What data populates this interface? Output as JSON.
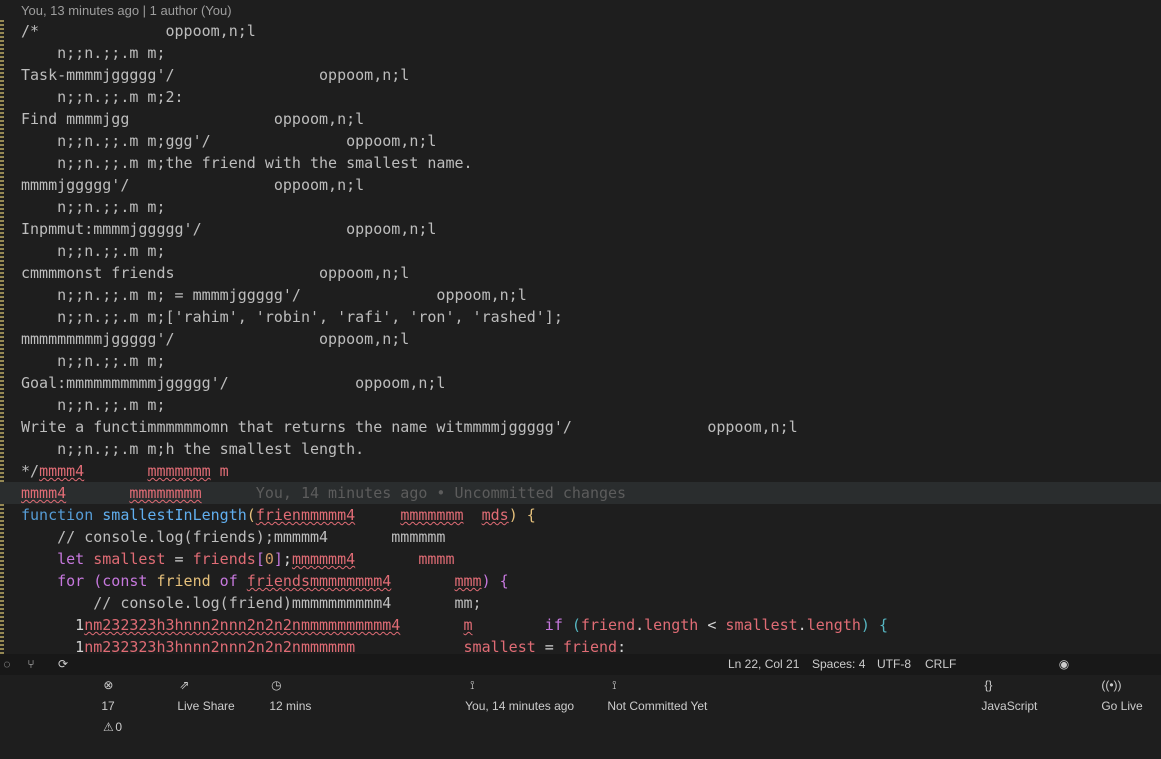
{
  "blame_header": "You, 13 minutes ago | 1 author (You)",
  "editor": {
    "lines": [
      {
        "segs": [
          {
            "t": "/*              oppoom,n;l",
            "c": "cm"
          }
        ]
      },
      {
        "segs": [
          {
            "t": "    n;;n.;;.m m;",
            "c": "cm"
          }
        ]
      },
      {
        "segs": [
          {
            "t": "Task-mmmmjggggg'/                oppoom,n;l",
            "c": "cm"
          }
        ]
      },
      {
        "segs": [
          {
            "t": "    n;;n.;;.m m;2:",
            "c": "cm"
          }
        ]
      },
      {
        "segs": [
          {
            "t": "Find mmmmjgg                oppoom,n;l",
            "c": "cm"
          }
        ]
      },
      {
        "segs": [
          {
            "t": "    n;;n.;;.m m;ggg'/               oppoom,n;l",
            "c": "cm"
          }
        ]
      },
      {
        "segs": [
          {
            "t": "    n;;n.;;.m m;the friend with the smallest name.",
            "c": "cm"
          }
        ]
      },
      {
        "segs": [
          {
            "t": "mmmmjggggg'/                oppoom,n;l",
            "c": "cm"
          }
        ]
      },
      {
        "segs": [
          {
            "t": "    n;;n.;;.m m;",
            "c": "cm"
          }
        ]
      },
      {
        "segs": [
          {
            "t": "Inpmmut:mmmmjggggg'/                oppoom,n;l",
            "c": "cm"
          }
        ]
      },
      {
        "segs": [
          {
            "t": "    n;;n.;;.m m;",
            "c": "cm"
          }
        ]
      },
      {
        "segs": [
          {
            "t": "cmmmmonst friends                oppoom,n;l",
            "c": "cm"
          }
        ]
      },
      {
        "segs": [
          {
            "t": "    n;;n.;;.m m; = mmmmjggggg'/               oppoom,n;l",
            "c": "cm"
          }
        ]
      },
      {
        "segs": [
          {
            "t": "    n;;n.;;.m m;['rahim', 'robin', 'rafi', 'ron', 'rashed'];",
            "c": "cm"
          }
        ]
      },
      {
        "segs": [
          {
            "t": "mmmmmmmmmjggggg'/                oppoom,n;l",
            "c": "cm"
          }
        ]
      },
      {
        "segs": [
          {
            "t": "    n;;n.;;.m m;",
            "c": "cm"
          }
        ]
      },
      {
        "segs": [
          {
            "t": "Goal:mmmmmmmmmmjggggg'/              oppoom,n;l",
            "c": "cm"
          }
        ]
      },
      {
        "segs": [
          {
            "t": "    n;;n.;;.m m;",
            "c": "cm"
          }
        ]
      },
      {
        "segs": [
          {
            "t": "Write a functimmmmmmomn that returns the name witmmmmjggggg'/               oppoom,n;l",
            "c": "cm"
          }
        ]
      },
      {
        "segs": [
          {
            "t": "    n;;n.;;.m m;h the smallest length.",
            "c": "cm"
          }
        ]
      },
      {
        "segs": [
          {
            "t": "*/",
            "c": "cm"
          },
          {
            "t": "mmmm4",
            "c": "err"
          },
          {
            "t": "       ",
            "c": "pr"
          },
          {
            "t": "mmmmmmm",
            "c": "err"
          },
          {
            "t": " m",
            "c": "rd"
          }
        ]
      },
      {
        "hl": true,
        "segs": [
          {
            "t": "mmmm4",
            "c": "err"
          },
          {
            "t": "       ",
            "c": "pr"
          },
          {
            "t": "mmmmmmmm",
            "c": "err"
          },
          {
            "t": "      You, 14 minutes ago • Uncommitted changes",
            "c": "ghost"
          }
        ]
      },
      {
        "segs": [
          {
            "t": "function",
            "c": "kwb"
          },
          {
            "t": " ",
            "c": "pr"
          },
          {
            "t": "smallestInLength",
            "c": "fn"
          },
          {
            "t": "(",
            "c": "br1"
          },
          {
            "t": "frienmmmmm4",
            "c": "err"
          },
          {
            "t": "     ",
            "c": "pr"
          },
          {
            "t": "mmmmmmm",
            "c": "err"
          },
          {
            "t": "  ",
            "c": "pr"
          },
          {
            "t": "mds",
            "c": "err"
          },
          {
            "t": ")",
            "c": "br1"
          },
          {
            "t": " {",
            "c": "br1"
          }
        ]
      },
      {
        "segs": [
          {
            "t": "    // console.log(friends);mmmmm4       mmmmmm",
            "c": "cm"
          }
        ]
      },
      {
        "segs": [
          {
            "t": "    ",
            "c": "pr"
          },
          {
            "t": "let",
            "c": "kw"
          },
          {
            "t": " ",
            "c": "pr"
          },
          {
            "t": "smallest",
            "c": "vr"
          },
          {
            "t": " = ",
            "c": "pr"
          },
          {
            "t": "friends",
            "c": "vr"
          },
          {
            "t": "[",
            "c": "br2"
          },
          {
            "t": "0",
            "c": "num"
          },
          {
            "t": "]",
            "c": "br2"
          },
          {
            "t": ";",
            "c": "pr"
          },
          {
            "t": "mmmmmm4",
            "c": "err"
          },
          {
            "t": "       ",
            "c": "pr"
          },
          {
            "t": "mmmm",
            "c": "rd"
          }
        ]
      },
      {
        "segs": [
          {
            "t": "    ",
            "c": "pr"
          },
          {
            "t": "for",
            "c": "kw"
          },
          {
            "t": " ",
            "c": "pr"
          },
          {
            "t": "(",
            "c": "br2"
          },
          {
            "t": "const",
            "c": "kw"
          },
          {
            "t": " ",
            "c": "pr"
          },
          {
            "t": "friend",
            "c": "gold"
          },
          {
            "t": " of ",
            "c": "kw"
          },
          {
            "t": "friendsmmmmmmmm4",
            "c": "err"
          },
          {
            "t": "       ",
            "c": "pr"
          },
          {
            "t": "mmm",
            "c": "err"
          },
          {
            "t": ")",
            "c": "br2"
          },
          {
            "t": " {",
            "c": "br2"
          }
        ]
      },
      {
        "segs": [
          {
            "t": "        // console.log(friend)mmmmmmmmmm4       mm;",
            "c": "cm"
          }
        ]
      },
      {
        "segs": [
          {
            "t": "      1",
            "c": "pr"
          },
          {
            "t": "nm232323h3hnnn2nnn2n2n2nmmmmmmmmmm4",
            "c": "err"
          },
          {
            "t": "       ",
            "c": "pr"
          },
          {
            "t": "m",
            "c": "err"
          },
          {
            "t": "        ",
            "c": "pr"
          },
          {
            "t": "if",
            "c": "kw"
          },
          {
            "t": " ",
            "c": "pr"
          },
          {
            "t": "(",
            "c": "br3"
          },
          {
            "t": "friend",
            "c": "vr"
          },
          {
            "t": ".",
            "c": "pr"
          },
          {
            "t": "length",
            "c": "vr"
          },
          {
            "t": " < ",
            "c": "pr"
          },
          {
            "t": "smallest",
            "c": "vr"
          },
          {
            "t": ".",
            "c": "pr"
          },
          {
            "t": "length",
            "c": "vr"
          },
          {
            "t": ")",
            "c": "br3"
          },
          {
            "t": " {",
            "c": "br3"
          }
        ]
      },
      {
        "segs": [
          {
            "t": "      1",
            "c": "pr"
          },
          {
            "t": "nm232323h3hnnn2nnn2n2n2nmmmmmm",
            "c": "rd"
          },
          {
            "t": "            ",
            "c": "pr"
          },
          {
            "t": "smallest",
            "c": "vr"
          },
          {
            "t": " = ",
            "c": "pr"
          },
          {
            "t": "friend",
            "c": "vr"
          },
          {
            "t": ":",
            "c": "pr"
          }
        ]
      }
    ]
  },
  "statusbar": {
    "problems": "17",
    "warnings": "0",
    "live_share": "Live Share",
    "timer": "12 mins",
    "blame": "You, 14 minutes ago",
    "commit": "Not Committed Yet",
    "cursor": "Ln 22, Col 21",
    "spaces": "Spaces: 4",
    "encoding": "UTF-8",
    "eol": "CRLF",
    "language": "JavaScript",
    "golive": "Go Live"
  }
}
